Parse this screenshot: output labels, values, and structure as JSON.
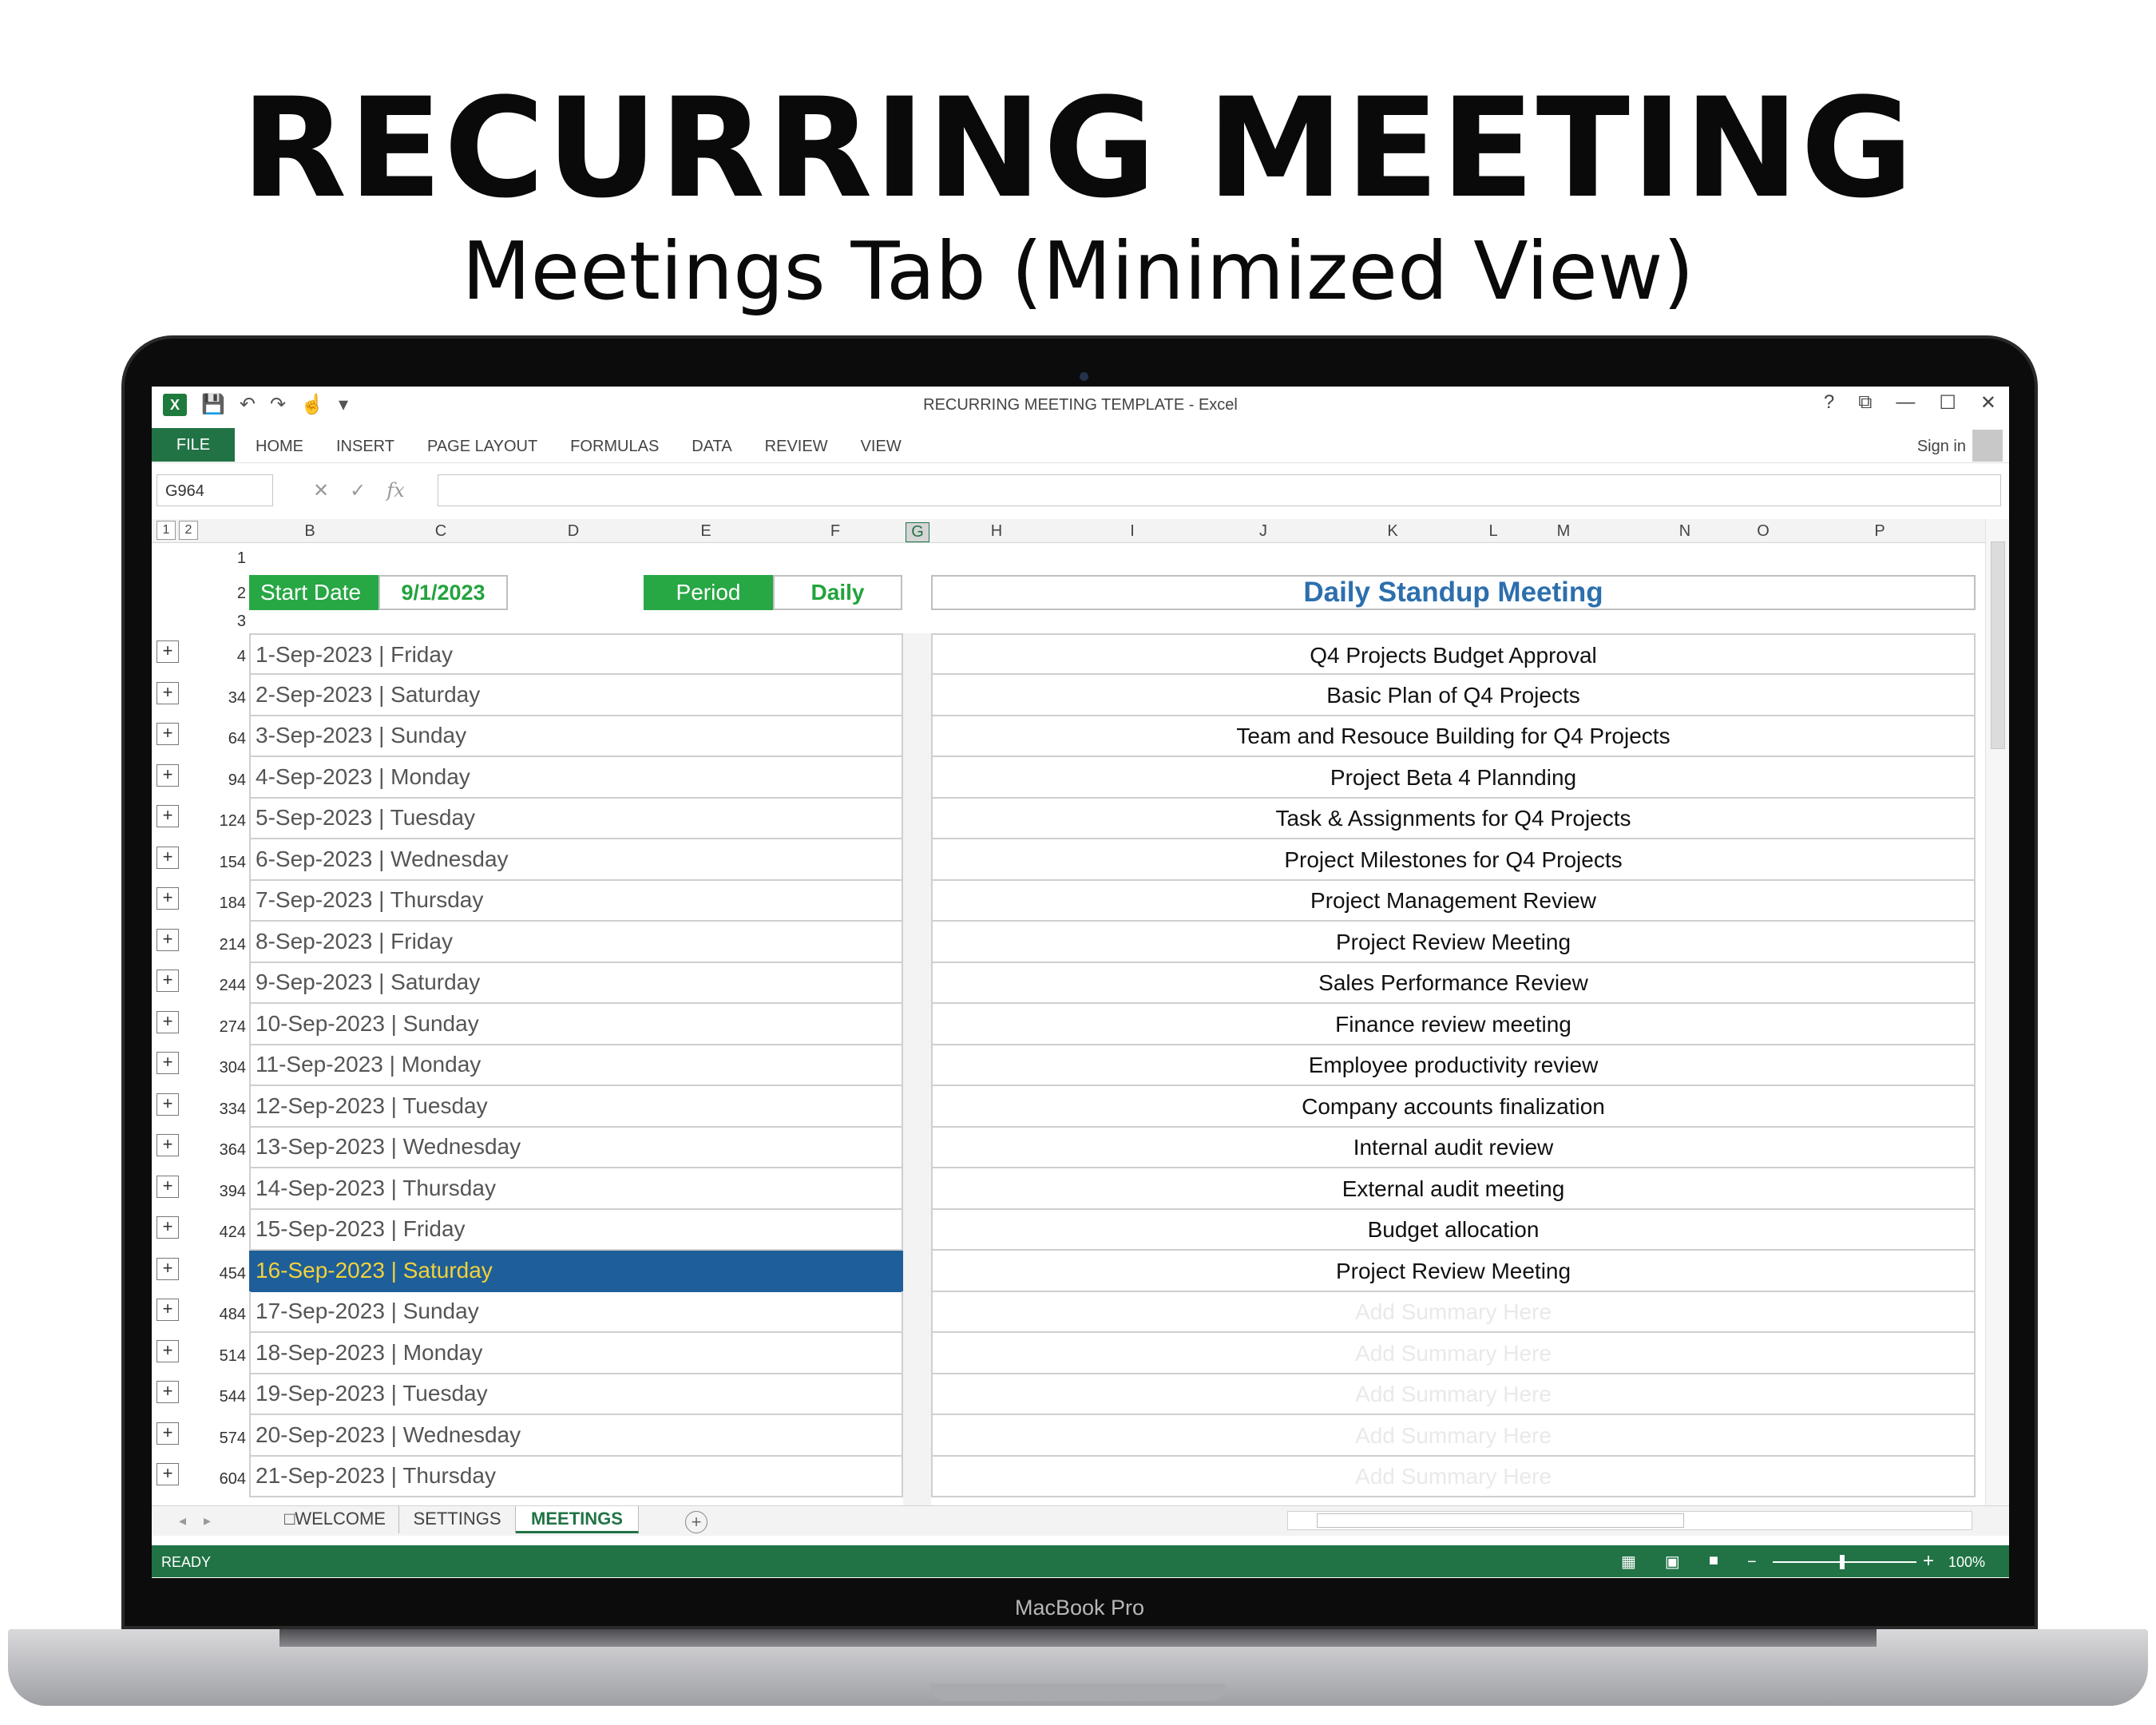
{
  "header": {
    "title": "RECURRING MEETING",
    "subtitle": "Meetings Tab (Minimized View)"
  },
  "laptop": {
    "brand": "MacBook Pro"
  },
  "window": {
    "title": "RECURRING MEETING TEMPLATE - Excel",
    "help": "?",
    "restore": "⧉",
    "minimize": "—",
    "maximize": "☐",
    "close": "✕"
  },
  "ribbon": {
    "file": "FILE",
    "tabs": [
      "HOME",
      "INSERT",
      "PAGE LAYOUT",
      "FORMULAS",
      "DATA",
      "REVIEW",
      "VIEW"
    ],
    "signin": "Sign in"
  },
  "formula_bar": {
    "namebox": "G964",
    "cancel": "✕",
    "enter": "✓",
    "fx": "fx",
    "value": ""
  },
  "columns": [
    "B",
    "C",
    "D",
    "E",
    "F",
    "G",
    "H",
    "I",
    "J",
    "K",
    "L",
    "M",
    "N",
    "O",
    "P"
  ],
  "outline_levels": [
    "1",
    "2"
  ],
  "sheet": {
    "start_date_label": "Start Date",
    "start_date_value": "9/1/2023",
    "period_label": "Period",
    "period_value": "Daily",
    "meeting_title": "Daily Standup Meeting",
    "header_rows": [
      "1",
      "2",
      "3"
    ],
    "rows": [
      {
        "row": "4",
        "date": "1-Sep-2023 | Friday",
        "summary": "Q4 Projects Budget Approval"
      },
      {
        "row": "34",
        "date": "2-Sep-2023 | Saturday",
        "summary": "Basic Plan of Q4 Projects"
      },
      {
        "row": "64",
        "date": "3-Sep-2023 | Sunday",
        "summary": "Team and Resouce Building for Q4 Projects"
      },
      {
        "row": "94",
        "date": "4-Sep-2023 | Monday",
        "summary": "Project Beta 4 Plannding"
      },
      {
        "row": "124",
        "date": "5-Sep-2023 | Tuesday",
        "summary": "Task & Assignments for Q4 Projects"
      },
      {
        "row": "154",
        "date": "6-Sep-2023 | Wednesday",
        "summary": "Project Milestones for Q4 Projects"
      },
      {
        "row": "184",
        "date": "7-Sep-2023 | Thursday",
        "summary": "Project Management Review"
      },
      {
        "row": "214",
        "date": "8-Sep-2023 | Friday",
        "summary": "Project Review Meeting"
      },
      {
        "row": "244",
        "date": "9-Sep-2023 | Saturday",
        "summary": "Sales Performance Review"
      },
      {
        "row": "274",
        "date": "10-Sep-2023 | Sunday",
        "summary": "Finance review meeting"
      },
      {
        "row": "304",
        "date": "11-Sep-2023 | Monday",
        "summary": "Employee productivity review"
      },
      {
        "row": "334",
        "date": "12-Sep-2023 | Tuesday",
        "summary": "Company accounts finalization"
      },
      {
        "row": "364",
        "date": "13-Sep-2023 | Wednesday",
        "summary": "Internal audit review"
      },
      {
        "row": "394",
        "date": "14-Sep-2023 | Thursday",
        "summary": "External audit meeting"
      },
      {
        "row": "424",
        "date": "15-Sep-2023 | Friday",
        "summary": "Budget allocation"
      },
      {
        "row": "454",
        "date": "16-Sep-2023 | Saturday",
        "summary": "Project Review Meeting",
        "selected": true
      },
      {
        "row": "484",
        "date": "17-Sep-2023 | Sunday",
        "summary": "Add Summary Here",
        "placeholder": true
      },
      {
        "row": "514",
        "date": "18-Sep-2023 | Monday",
        "summary": "Add Summary Here",
        "placeholder": true
      },
      {
        "row": "544",
        "date": "19-Sep-2023 | Tuesday",
        "summary": "Add Summary Here",
        "placeholder": true
      },
      {
        "row": "574",
        "date": "20-Sep-2023 | Wednesday",
        "summary": "Add Summary Here",
        "placeholder": true
      },
      {
        "row": "604",
        "date": "21-Sep-2023 | Thursday",
        "summary": "Add Summary Here",
        "placeholder": true
      }
    ]
  },
  "sheet_tabs": [
    "□WELCOME",
    "SETTINGS",
    "MEETINGS"
  ],
  "active_sheet": "MEETINGS",
  "status": {
    "text": "READY",
    "zoom": "100%"
  },
  "colors": {
    "excel_green": "#217346",
    "label_green": "#28a745",
    "title_blue": "#2c6fad",
    "selection_blue": "#1e5f99",
    "selection_text": "#f2d13a"
  }
}
